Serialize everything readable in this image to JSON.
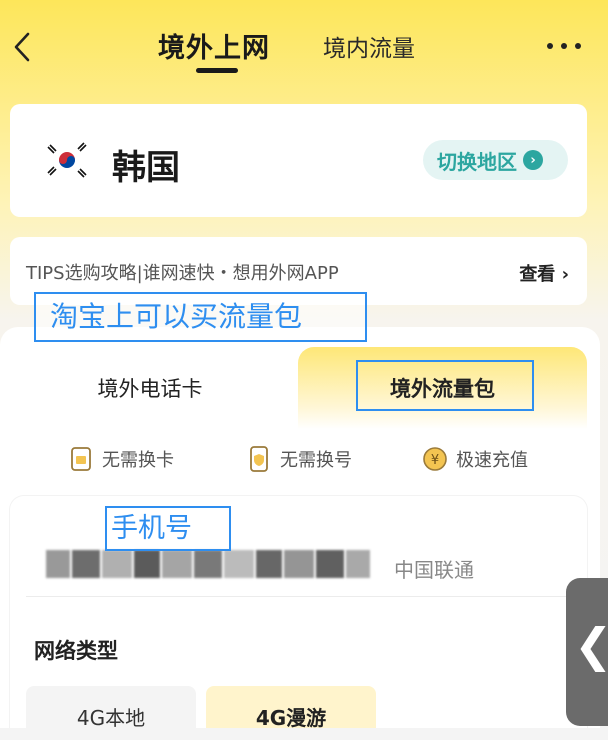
{
  "nav": {
    "tab_active": "境外上网",
    "tab_other": "境内流量",
    "back_icon": "chevron-left-icon",
    "more_icon": "more-dots-icon"
  },
  "region": {
    "name": "韩国",
    "flag_icon": "korea-flag-icon",
    "switch_label": "切换地区",
    "switch_icon": "arrow-right-circle-icon"
  },
  "tips": {
    "text": "TIPS选购攻略|谁网速快・想用外网APP",
    "more_label": "查看 ›"
  },
  "segments": {
    "left": "境外电话卡",
    "right": "境外流量包"
  },
  "features": [
    {
      "label": "无需换卡",
      "icon": "sim-card-icon"
    },
    {
      "label": "无需换号",
      "icon": "phone-shield-icon"
    },
    {
      "label": "极速充值",
      "icon": "yuan-coin-icon"
    }
  ],
  "phone": {
    "carrier": "中国联通"
  },
  "network": {
    "label": "网络类型",
    "options": [
      "4G本地",
      "4G漫游"
    ],
    "selected": "4G漫游"
  },
  "annotations": {
    "taobao": "淘宝上可以买流量包",
    "phone_number": "手机号"
  },
  "side_handle": {
    "glyph": "❮"
  },
  "colors": {
    "brand_yellow": "#FDE65A",
    "teal_accent": "#2CA6A0",
    "annotation_blue": "#2E8EF0"
  }
}
